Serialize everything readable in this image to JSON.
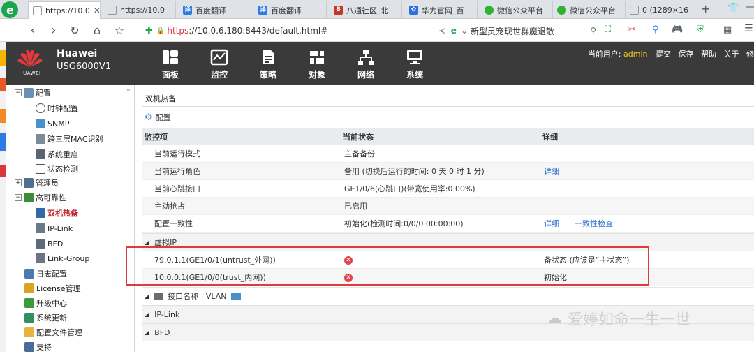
{
  "browser": {
    "tabs": [
      {
        "label": "https://10.0",
        "active": true
      },
      {
        "label": "https://10.0"
      },
      {
        "label": "百度翻译"
      },
      {
        "label": "百度翻译"
      },
      {
        "label": "八通社区_北"
      },
      {
        "label": "华为官网_百"
      },
      {
        "label": "微信公众平台"
      },
      {
        "label": "微信公众平台"
      },
      {
        "label": "0 (1289×16"
      }
    ],
    "url_scheme": "https",
    "url_rest": "://10.0.6.180:8443/default.html#",
    "search_text": "新型灵宠现世群魔退散"
  },
  "app": {
    "brand": "Huawei",
    "model": "USG6000V1",
    "logo_text": "HUAWEI",
    "nav": [
      {
        "label": "面板",
        "icon": "dashboard-icon"
      },
      {
        "label": "监控",
        "icon": "monitor-icon"
      },
      {
        "label": "策略",
        "icon": "policy-icon"
      },
      {
        "label": "对象",
        "icon": "object-icon"
      },
      {
        "label": "网络",
        "icon": "network-icon"
      },
      {
        "label": "系统",
        "icon": "system-icon"
      }
    ],
    "user_prefix": "当前用户:",
    "user": "admin",
    "actions": [
      "提交",
      "保存",
      "帮助",
      "关于",
      "修"
    ]
  },
  "sidebar": {
    "items": [
      {
        "label": "配置",
        "level": 0,
        "expander": "−"
      },
      {
        "label": "时钟配置",
        "level": 1
      },
      {
        "label": "SNMP",
        "level": 1
      },
      {
        "label": "跨三层MAC识别",
        "level": 1
      },
      {
        "label": "系统重启",
        "level": 1
      },
      {
        "label": "状态检测",
        "level": 1
      },
      {
        "label": "管理员",
        "level": 0,
        "expander": "+"
      },
      {
        "label": "高可靠性",
        "level": 0,
        "expander": "−"
      },
      {
        "label": "双机热备",
        "level": 1,
        "active": true
      },
      {
        "label": "IP-Link",
        "level": 1
      },
      {
        "label": "BFD",
        "level": 1
      },
      {
        "label": "Link-Group",
        "level": 1
      },
      {
        "label": "日志配置",
        "level": 0
      },
      {
        "label": "License管理",
        "level": 0
      },
      {
        "label": "升级中心",
        "level": 0
      },
      {
        "label": "系统更新",
        "level": 0
      },
      {
        "label": "配置文件管理",
        "level": 0
      },
      {
        "label": "支持",
        "level": 0
      }
    ]
  },
  "main": {
    "title": "双机热备",
    "config_label": "配置",
    "headers": [
      "监控项",
      "当前状态",
      "详细"
    ],
    "rows": [
      {
        "item": "当前运行模式",
        "status": "主备备份",
        "detail": ""
      },
      {
        "item": "当前运行角色",
        "status": "备用 (切换后运行的时间: 0 天 0 时 1 分)",
        "detail": "详细"
      },
      {
        "item": "当前心跳接口",
        "status": "GE1/0/6(心跳口)(带宽使用率:0.00%)",
        "detail": ""
      },
      {
        "item": "主动抢占",
        "status": "已启用",
        "detail": ""
      },
      {
        "item": "配置一致性",
        "status": "初始化(检测时间:0/0/0 00:00:00)",
        "detail": "详细",
        "detail2": "一致性检查"
      }
    ],
    "vip_section": "虚拟IP",
    "vip_rows": [
      {
        "item": "79.0.1.1(GE1/0/1(untrust_外网))",
        "detail": "备状态 (应该是“主状态”)"
      },
      {
        "item": "10.0.0.1(GE1/0/0(trust_内网))",
        "detail": "初始化"
      }
    ],
    "iface_section": "接口名称 | VLAN",
    "iplink_section": "IP-Link",
    "bfd_section": "BFD"
  },
  "watermark": "爱婷如命一生一世",
  "colors": {
    "highlight_box": "#e0393e",
    "header_bg": "#3a3a3a",
    "link": "#2a6fc9"
  }
}
